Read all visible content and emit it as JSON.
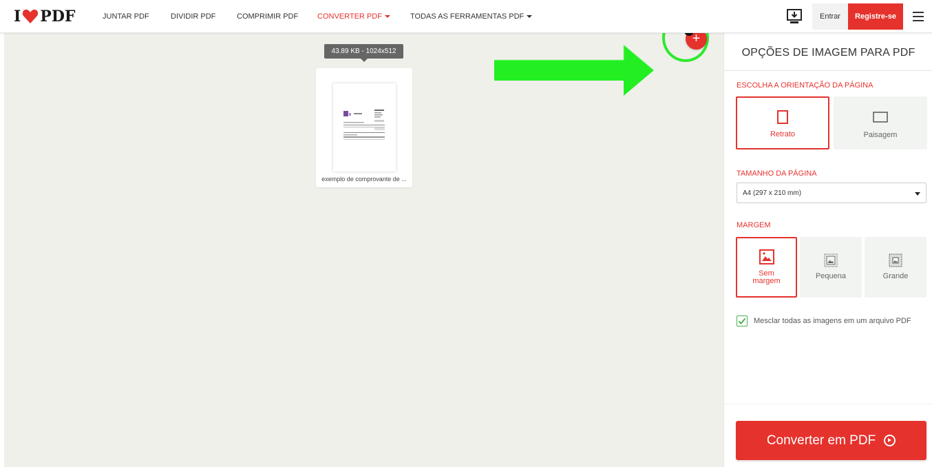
{
  "header": {
    "logo_text_left": "I",
    "logo_text_right": "PDF",
    "nav": [
      {
        "label": "JUNTAR PDF"
      },
      {
        "label": "DIVIDIR PDF"
      },
      {
        "label": "COMPRIMIR PDF"
      },
      {
        "label": "CONVERTER PDF"
      },
      {
        "label": "TODAS AS FERRAMENTAS PDF"
      }
    ],
    "login_label": "Entrar",
    "register_label": "Registre-se"
  },
  "workspace": {
    "file_tooltip": "43.89 KB - 1024x512",
    "file_name": "exemplo de comprovante de ...",
    "add_badge_count": "1"
  },
  "sidebar": {
    "title": "OPÇÕES DE IMAGEM PARA PDF",
    "orientation_label": "ESCOLHA A ORIENTAÇÃO DA PÁGINA",
    "orientation_options": [
      {
        "label": "Retrato",
        "selected": true
      },
      {
        "label": "Paisagem",
        "selected": false
      }
    ],
    "page_size_label": "TAMANHO DA PÁGINA",
    "page_size_value": "A4 (297 x 210 mm)",
    "margin_label": "MARGEM",
    "margin_options": [
      {
        "label": "Sem margem",
        "selected": true
      },
      {
        "label": "Pequena",
        "selected": false
      },
      {
        "label": "Grande",
        "selected": false
      }
    ],
    "merge_checkbox_label": "Mesclar todas as imagens em um arquivo PDF",
    "merge_checked": true,
    "convert_label": "Converter em PDF"
  },
  "colors": {
    "brand_red": "#e5322d",
    "highlight_green": "#2fe92f",
    "workspace_bg": "#f0f0eb"
  }
}
